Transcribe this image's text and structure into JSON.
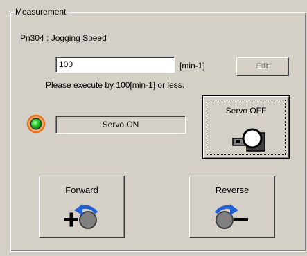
{
  "group": {
    "title": "Measurement"
  },
  "parameter": {
    "label": "Pn304 : Jogging Speed"
  },
  "speed": {
    "value": "100",
    "unit": "[min-1]"
  },
  "edit_button": {
    "label": "Edit",
    "enabled": false
  },
  "hint": {
    "text": "Please execute by 100[min-1] or less."
  },
  "servo": {
    "status_text": "Servo ON",
    "button_label": "Servo OFF",
    "led_color": "#22cc22",
    "led_ring_color": "#f07a10"
  },
  "jog": {
    "forward_label": "Forward",
    "reverse_label": "Reverse",
    "arrow_color": "#1f5fd6"
  }
}
